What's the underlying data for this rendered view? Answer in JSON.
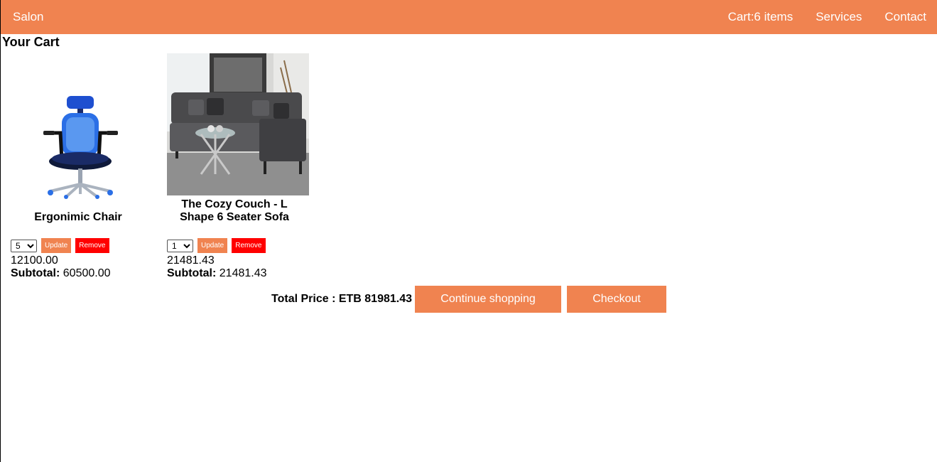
{
  "navbar": {
    "brand": "Salon",
    "cart_link": "Cart:6 items",
    "services_link": "Services",
    "contact_link": "Contact"
  },
  "cart": {
    "title": "Your Cart",
    "items": [
      {
        "name": "Ergonimic Chair",
        "image": "office-chair-photo",
        "quantity": "5",
        "update_label": "Update",
        "remove_label": "Remove",
        "price": "12100.00",
        "subtotal_label": "Subtotal:",
        "subtotal": "60500.00"
      },
      {
        "name": "The Cozy Couch - L Shape 6 Seater Sofa",
        "image": "l-shape-sofa-photo",
        "quantity": "1",
        "update_label": "Update",
        "remove_label": "Remove",
        "price": "21481.43",
        "subtotal_label": "Subtotal:",
        "subtotal": "21481.43"
      }
    ],
    "total_text": "Total Price : ETB 81981.43",
    "continue_label": "Continue shopping",
    "checkout_label": "Checkout"
  },
  "colors": {
    "accent": "#f08350",
    "remove": "#ff0000"
  }
}
